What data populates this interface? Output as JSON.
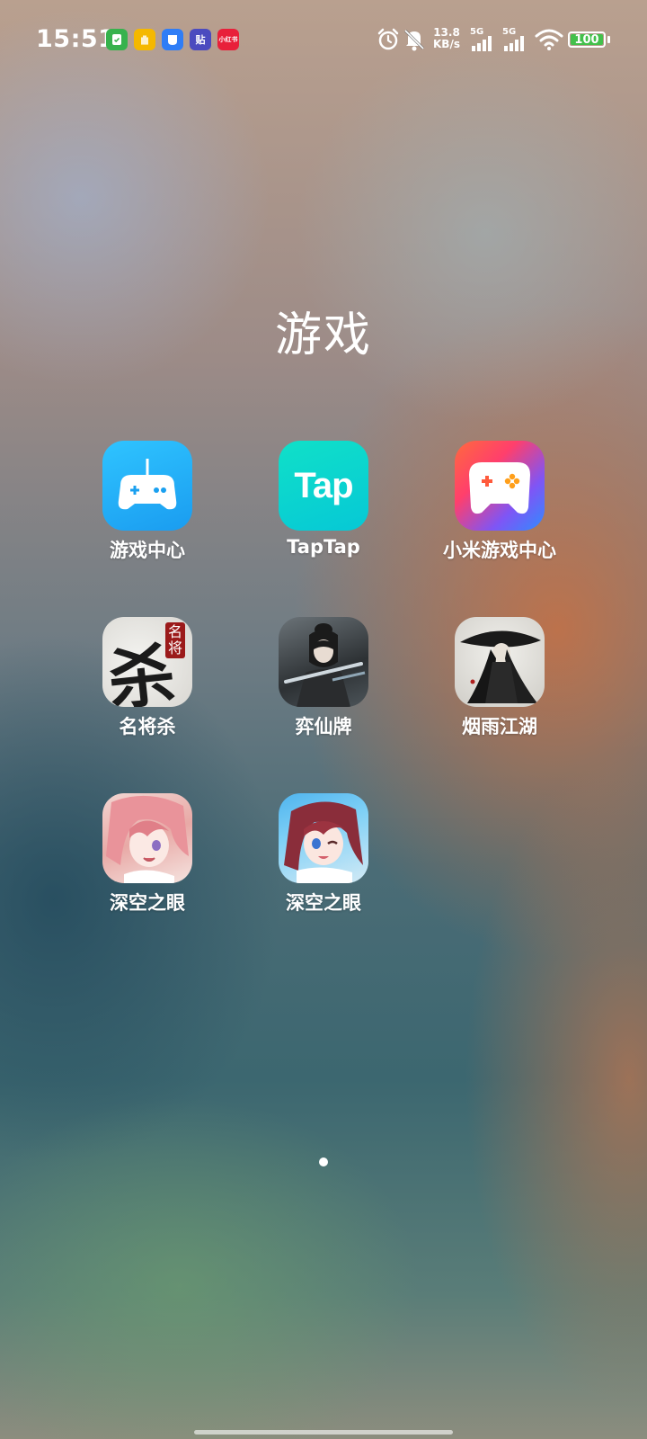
{
  "status_bar": {
    "time": "15:51",
    "notification_icons": [
      {
        "name": "security-app-icon",
        "color": "#37b24d"
      },
      {
        "name": "hand-app-icon",
        "color": "#f5b800"
      },
      {
        "name": "browser-app-icon",
        "color": "#2f7df6"
      },
      {
        "name": "tieba-app-icon",
        "color": "#4b4bbf",
        "text": "贴"
      },
      {
        "name": "xiaohongshu-app-icon",
        "color": "#e8203a",
        "text": "小红书"
      }
    ],
    "net_rate_value": "13.8",
    "net_rate_unit": "KB/s",
    "sim1_label": "5G",
    "sim2_label": "5G",
    "battery_level": "100",
    "battery_color": "#43c04b"
  },
  "folder": {
    "title": "游戏",
    "apps": [
      {
        "label": "游戏中心",
        "icon": "gamepad-icon"
      },
      {
        "label": "TapTap",
        "icon": "taptap-logo-icon"
      },
      {
        "label": "小米游戏中心",
        "icon": "mi-game-controller-icon"
      },
      {
        "label": "名将杀",
        "icon": "mingjiangsha-icon"
      },
      {
        "label": "弈仙牌",
        "icon": "yixianpai-icon"
      },
      {
        "label": "烟雨江湖",
        "icon": "yanyujianghu-icon"
      },
      {
        "label": "深空之眼",
        "icon": "shenkongzhiyan-icon-1"
      },
      {
        "label": "深空之眼",
        "icon": "shenkongzhiyan-icon-2"
      }
    ],
    "icon_texts": {
      "taptap": "Tap",
      "mingjiangsha_char": "杀",
      "mingjiangsha_seal": "名将"
    }
  },
  "pager": {
    "pages": 1,
    "current": 1
  }
}
